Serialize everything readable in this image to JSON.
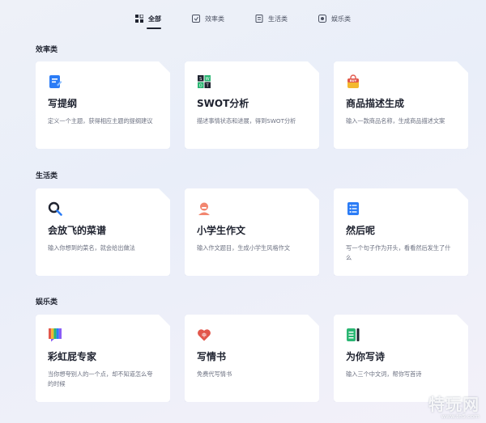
{
  "tabs": [
    {
      "label": "全部",
      "icon": "grid-icon",
      "active": true
    },
    {
      "label": "效率类",
      "icon": "efficiency-icon",
      "active": false
    },
    {
      "label": "生活类",
      "icon": "life-icon",
      "active": false
    },
    {
      "label": "娱乐类",
      "icon": "entertainment-icon",
      "active": false
    }
  ],
  "sections": [
    {
      "title": "效率类",
      "cards": [
        {
          "title": "写提纲",
          "desc": "定义一个主题，获得相应主题的提纲建议",
          "icon": "outline-doc-icon"
        },
        {
          "title": "SWOT分析",
          "desc": "描述事情状态和进展，得到SWOT分析",
          "icon": "swot-grid-icon"
        },
        {
          "title": "商品描述生成",
          "desc": "输入一款商品名称，生成商品描述文案",
          "icon": "shopping-bag-icon"
        }
      ]
    },
    {
      "title": "生活类",
      "cards": [
        {
          "title": "会放飞的菜谱",
          "desc": "输入你想到的菜名，就会给出做法",
          "icon": "magnifier-icon"
        },
        {
          "title": "小学生作文",
          "desc": "输入作文题目，生成小学生风格作文",
          "icon": "student-avatar-icon"
        },
        {
          "title": "然后呢",
          "desc": "写一个句子作为开头，看看然后发生了什么",
          "icon": "story-doc-icon"
        }
      ]
    },
    {
      "title": "娱乐类",
      "cards": [
        {
          "title": "彩虹屁专家",
          "desc": "当你想夸别人的一个点，却不知道怎么夸的时候",
          "icon": "rainbow-chat-icon"
        },
        {
          "title": "写情书",
          "desc": "免费代写情书",
          "icon": "heart-icon"
        },
        {
          "title": "为你写诗",
          "desc": "输入三个中文词，帮你写首诗",
          "icon": "poem-doc-icon"
        }
      ]
    }
  ],
  "watermark": {
    "main": "特玩网",
    "sub": "www.te5.com"
  }
}
